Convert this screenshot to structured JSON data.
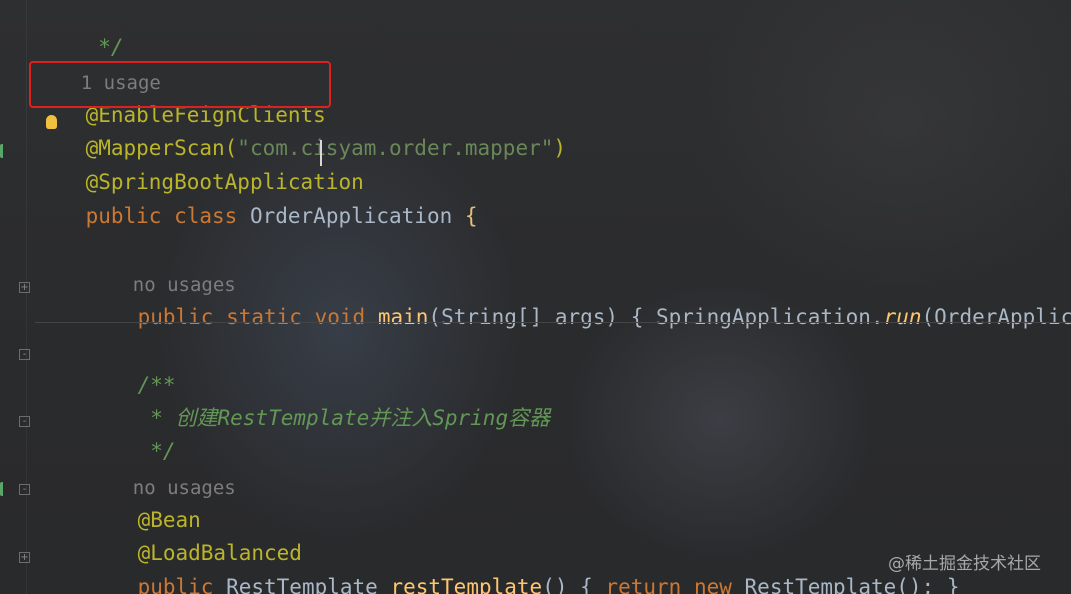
{
  "editor": {
    "lines": {
      "comment_close": " */",
      "usage_1": "1 usage",
      "enable_feign": "@EnableFeignClients",
      "mapper_scan_ann": "@MapperScan(",
      "mapper_scan_value": "\"com.cisyam.order.mapper\"",
      "mapper_scan_close": ")",
      "spring_boot_app": "@SpringBootApplication",
      "public_kw": "public",
      "class_kw": "class",
      "class_name": "OrderApplication",
      "open_brace": "{",
      "usage_2": "no usages",
      "main_public": "public",
      "main_static": "static",
      "main_void": "void",
      "main_name": "main",
      "main_params": "(String[] args) { SpringApplication.",
      "main_run": "run",
      "main_rest": "(OrderApplicat",
      "doc_open": "/**",
      "doc_text": " * 创建RestTemplate并注入Spring容器",
      "doc_close": " */",
      "usage_3": "no usages",
      "bean_ann": "@Bean",
      "load_balanced_ann": "@LoadBalanced",
      "rt_public": "public",
      "rt_type": "RestTemplate",
      "rt_name": "restTemplate",
      "rt_parens": "() {",
      "rt_return": "return",
      "rt_new": "new",
      "rt_ctor": "RestTemplate(); }"
    },
    "highlight_color": "#e02020"
  },
  "watermark": "@稀土掘金技术社区",
  "icons": [
    "run-gutter-icon",
    "lightbulb-icon",
    "fold-icon"
  ]
}
